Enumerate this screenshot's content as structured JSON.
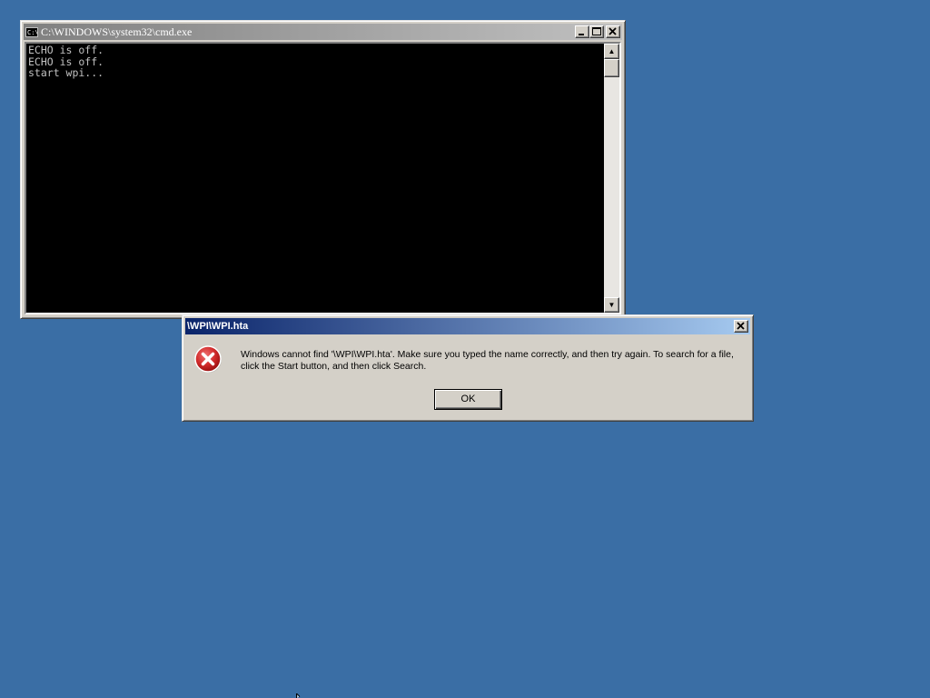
{
  "desktop": {
    "background_color": "#3a6ea5"
  },
  "cmd_window": {
    "title": "C:\\WINDOWS\\system32\\cmd.exe",
    "icon": "cmd-icon",
    "icon_text": "C:\\.",
    "console_lines": [
      "ECHO is off.",
      "ECHO is off.",
      "start wpi..."
    ],
    "buttons": {
      "minimize": "minimize-icon",
      "maximize": "maximize-icon",
      "close": "close-icon"
    },
    "scroll_up": "▲",
    "scroll_down": "▼"
  },
  "error_dialog": {
    "title": "\\WPI\\WPI.hta",
    "icon": "error-icon",
    "message": "Windows cannot find '\\WPI\\WPI.hta'. Make sure you typed the name correctly, and then try again. To search for a file, click the Start button, and then click Search.",
    "ok_label": "OK",
    "close_icon": "close-icon"
  },
  "colors": {
    "active_title_start": "#0a246a",
    "active_title_end": "#a6caf0",
    "inactive_title_start": "#808080",
    "inactive_title_end": "#c0c0c0",
    "error_red": "#c8202a"
  }
}
